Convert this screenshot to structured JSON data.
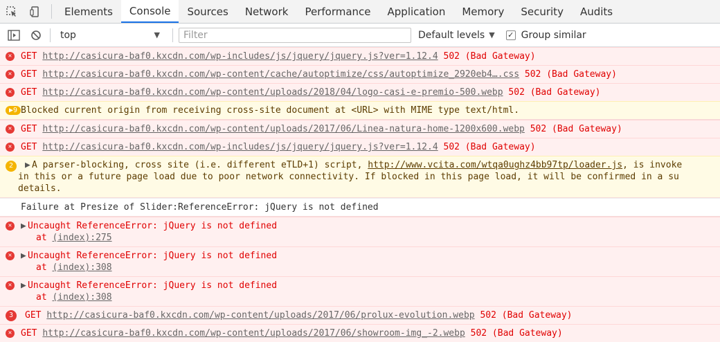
{
  "tabs": [
    "Elements",
    "Console",
    "Sources",
    "Network",
    "Performance",
    "Application",
    "Memory",
    "Security",
    "Audits"
  ],
  "toolbar": {
    "context": "top",
    "filter_placeholder": "Filter",
    "levels": "Default levels",
    "group_similar": "Group similar"
  },
  "messages": {
    "m1": {
      "method": "GET",
      "url": "http://casicura-baf0.kxcdn.com/wp-includes/js/jquery/jquery.js?ver=1.12.4",
      "status": "502 (Bad Gateway)"
    },
    "m2": {
      "method": "GET",
      "url": "http://casicura-baf0.kxcdn.com/wp-content/cache/autoptimize/css/autoptimize_2920eb4….css",
      "status": "502 (Bad Gateway)"
    },
    "m3": {
      "method": "GET",
      "url": "http://casicura-baf0.kxcdn.com/wp-content/uploads/2018/04/logo-casi-e-premio-500.webp",
      "status": "502 (Bad Gateway)"
    },
    "m4": {
      "count": "9",
      "text": "Blocked current origin from receiving cross-site document at <URL> with MIME type text/html."
    },
    "m5": {
      "method": "GET",
      "url": "http://casicura-baf0.kxcdn.com/wp-content/uploads/2017/06/Linea-natura-home-1200x600.webp",
      "status": "502 (Bad Gateway)"
    },
    "m6": {
      "method": "GET",
      "url": "http://casicura-baf0.kxcdn.com/wp-includes/js/jquery/jquery.js?ver=1.12.4",
      "status": "502 (Bad Gateway)"
    },
    "m7": {
      "count": "2",
      "text1": "A parser-blocking, cross site (i.e. different eTLD+1) script, ",
      "url": "http://www.vcita.com/wtqa0ughz4bb97tp/loader.js",
      "text2": ", is invoke",
      "line2": "in this or a future page load due to poor network connectivity. If blocked in this page load, it will be confirmed in a su",
      "line3": "details."
    },
    "m8": {
      "text": "Failure at Presize of Slider:ReferenceError: jQuery is not defined"
    },
    "m9": {
      "text": "Uncaught ReferenceError: jQuery is not defined",
      "at": "at ",
      "loc": "(index):275"
    },
    "m10": {
      "text": "Uncaught ReferenceError: jQuery is not defined",
      "at": "at ",
      "loc": "(index):308"
    },
    "m11": {
      "text": "Uncaught ReferenceError: jQuery is not defined",
      "at": "at ",
      "loc": "(index):308"
    },
    "m12": {
      "count": "3",
      "method": "GET",
      "url": "http://casicura-baf0.kxcdn.com/wp-content/uploads/2017/06/prolux-evolution.webp",
      "status": "502 (Bad Gateway)"
    },
    "m13": {
      "method": "GET",
      "url": "http://casicura-baf0.kxcdn.com/wp-content/uploads/2017/06/showroom-img_-2.webp",
      "status": "502 (Bad Gateway)"
    }
  },
  "icons": {
    "error": "✕",
    "expand": "▶"
  }
}
